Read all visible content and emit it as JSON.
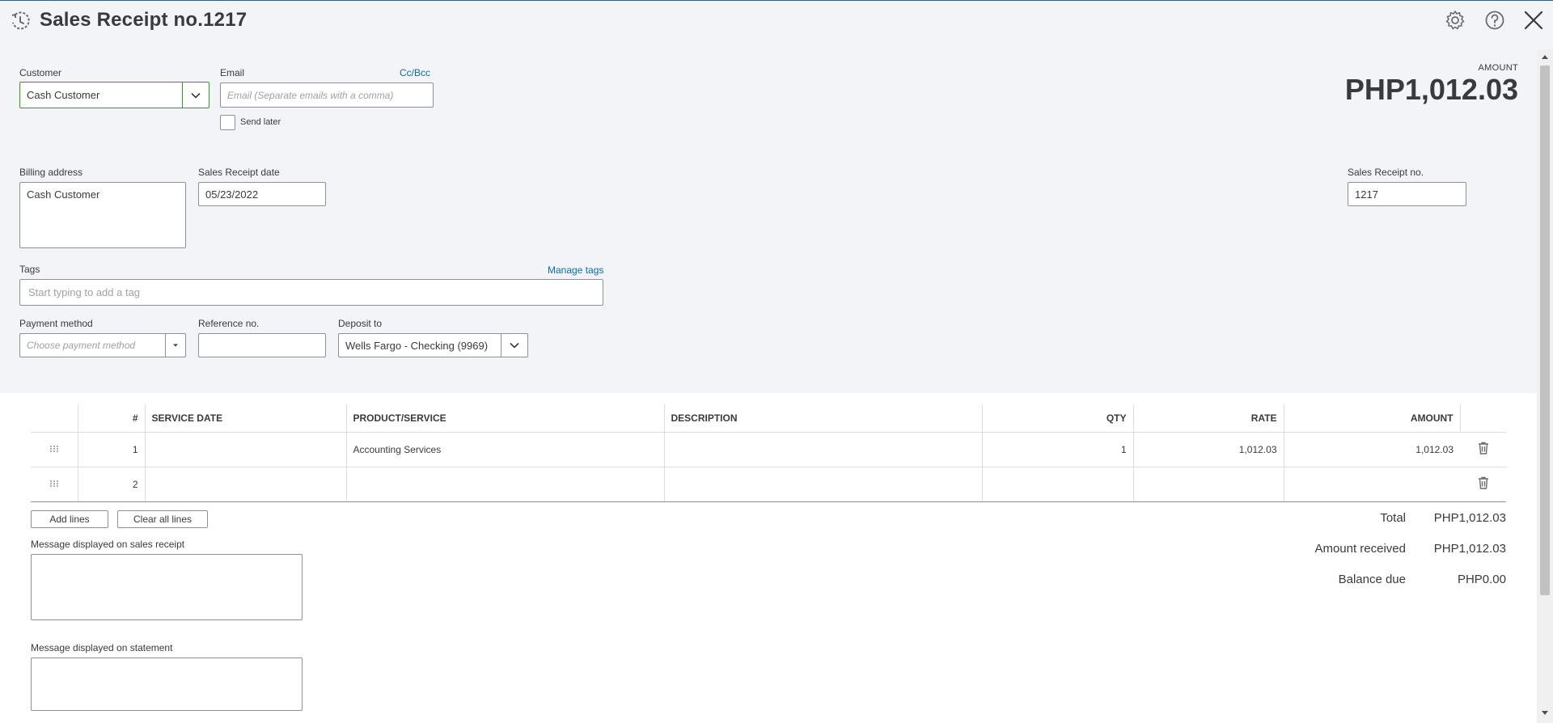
{
  "header": {
    "title": "Sales Receipt no.1217"
  },
  "customer": {
    "label": "Customer",
    "value": "Cash Customer"
  },
  "email": {
    "label": "Email",
    "cc_bcc": "Cc/Bcc",
    "placeholder": "Email (Separate emails with a comma)",
    "send_later": "Send later"
  },
  "amount": {
    "label": "AMOUNT",
    "value": "PHP1,012.03"
  },
  "billing": {
    "label": "Billing address",
    "value": "Cash Customer"
  },
  "receipt_date": {
    "label": "Sales Receipt date",
    "value": "05/23/2022"
  },
  "receipt_no": {
    "label": "Sales Receipt no.",
    "value": "1217"
  },
  "tags": {
    "label": "Tags",
    "manage": "Manage tags",
    "placeholder": "Start typing to add a tag"
  },
  "payment_method": {
    "label": "Payment method",
    "placeholder": "Choose payment method"
  },
  "reference": {
    "label": "Reference no.",
    "value": ""
  },
  "deposit_to": {
    "label": "Deposit to",
    "value": "Wells Fargo - Checking (9969)"
  },
  "table": {
    "columns": [
      "#",
      "SERVICE DATE",
      "PRODUCT/SERVICE",
      "DESCRIPTION",
      "QTY",
      "RATE",
      "AMOUNT"
    ],
    "rows": [
      {
        "num": "1",
        "service_date": "",
        "product": "Accounting Services",
        "description": "",
        "qty": "1",
        "rate": "1,012.03",
        "amount": "1,012.03"
      },
      {
        "num": "2",
        "service_date": "",
        "product": "",
        "description": "",
        "qty": "",
        "rate": "",
        "amount": ""
      }
    ]
  },
  "buttons": {
    "add_lines": "Add lines",
    "clear_all": "Clear all lines"
  },
  "totals": {
    "total_label": "Total",
    "total_value": "PHP1,012.03",
    "received_label": "Amount received",
    "received_value": "PHP1,012.03",
    "balance_label": "Balance due",
    "balance_value": "PHP0.00"
  },
  "messages": {
    "receipt_label": "Message displayed on sales receipt",
    "statement_label": "Message displayed on statement"
  },
  "icons": {
    "history": "history-clock-icon",
    "settings": "gear-icon",
    "help": "help-icon",
    "close": "close-icon",
    "drag": "drag-handle-icon",
    "delete": "trash-icon"
  },
  "colors": {
    "header_bg": "#f3f4f8",
    "link": "#0b6cb3",
    "customer_border": "#2ca01c",
    "text": "#393a3d"
  }
}
